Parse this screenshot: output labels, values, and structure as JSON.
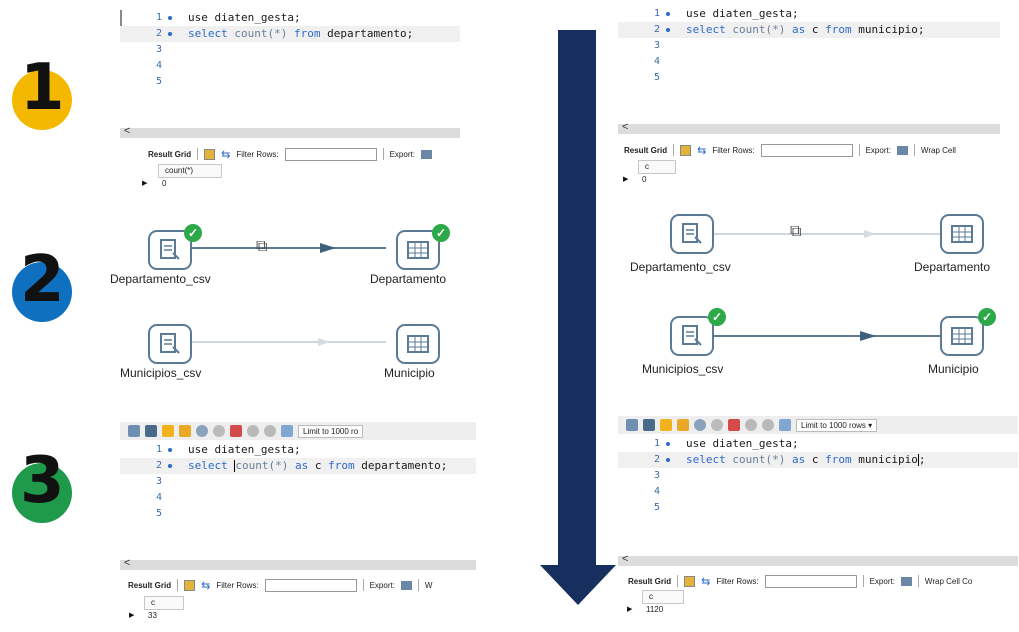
{
  "steps": [
    "1",
    "2",
    "3"
  ],
  "step_colors": {
    "step1": "#f5b800",
    "step2": "#1070c0",
    "step3": "#1e9a4a"
  },
  "arrow_color": "#172f5f",
  "results_bar": {
    "result_grid": "Result Grid",
    "filter_rows": "Filter Rows:",
    "export": "Export:",
    "wrap_cell": "Wrap Cell",
    "wrap_cell_content": "Wrap Cell Co",
    "wrap_short": "W"
  },
  "toolbar": {
    "limit": "Limit to 1000 rows",
    "limit_trunc": "Limit to 1000 ro"
  },
  "line_numbers": [
    "1",
    "2",
    "3",
    "4",
    "5"
  ],
  "sql": {
    "use_stmt": "use diaten_gesta;",
    "q1_kw1": "select",
    "q1_fn": "count(*)",
    "q1_kw2": "from",
    "q1_tbl": "departamento;",
    "q1r_kw1": "select",
    "q1r_fn": "count(*)",
    "q1r_kw2": "as",
    "q1r_alias": "c",
    "q1r_kw3": "from",
    "q1r_tbl": "municipio;",
    "q3_kw1": "select",
    "q3_fn": "count(*)",
    "q3_kw2": "as",
    "q3_alias": "c",
    "q3_kw3": "from",
    "q3_tbl": "departamento;",
    "q3r_kw1": "select",
    "q3r_fn": "count(*)",
    "q3r_kw2": "as",
    "q3r_alias": "c",
    "q3r_kw3": "from",
    "q3r_tbl_a": "municipio",
    "q3r_tbl_b": ";"
  },
  "grids": {
    "g1_col": "count(*)",
    "g1_val": "0",
    "g1r_col": "c",
    "g1r_val": "0",
    "g3_col": "c",
    "g3_val": "33",
    "g3r_col": "c",
    "g3r_val": "1120"
  },
  "etl": {
    "dep_csv": "Departamento_csv",
    "dep": "Departamento",
    "mun_csv": "Municipios_csv",
    "mun": "Municipio"
  },
  "scroll_left": "<"
}
